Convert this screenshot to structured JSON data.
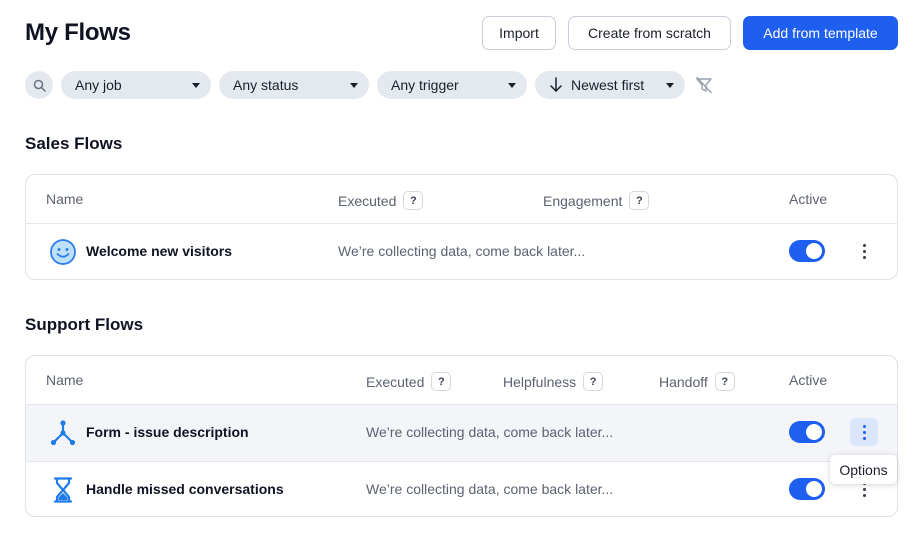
{
  "page": {
    "title": "My Flows"
  },
  "toolbar": {
    "import_label": "Import",
    "create_label": "Create from scratch",
    "template_label": "Add from template"
  },
  "filters": {
    "job": "Any job",
    "status": "Any status",
    "trigger": "Any trigger",
    "sort": "Newest first"
  },
  "sales": {
    "title": "Sales Flows",
    "columns": {
      "name": "Name",
      "executed": "Executed",
      "engagement": "Engagement",
      "active": "Active"
    },
    "help_mark": "?",
    "rows": [
      {
        "name": "Welcome new visitors",
        "status": "We’re collecting data, come back later...",
        "active": true,
        "icon": "smiley-face-icon"
      }
    ]
  },
  "support": {
    "title": "Support Flows",
    "columns": {
      "name": "Name",
      "executed": "Executed",
      "helpfulness": "Helpfulness",
      "handoff": "Handoff",
      "active": "Active"
    },
    "help_mark": "?",
    "rows": [
      {
        "name": "Form - issue description",
        "status": "We’re collecting data, come back later...",
        "active": true,
        "icon": "branch-split-icon"
      },
      {
        "name": "Handle missed conversations",
        "status": "We’re collecting data, come back later...",
        "active": true,
        "icon": "hourglass-icon"
      }
    ]
  },
  "tooltip": {
    "text": "Options"
  },
  "colors": {
    "accent": "#1f5ff0",
    "chip": "#e4e8ef",
    "row_hover": "#f3f5f9"
  }
}
